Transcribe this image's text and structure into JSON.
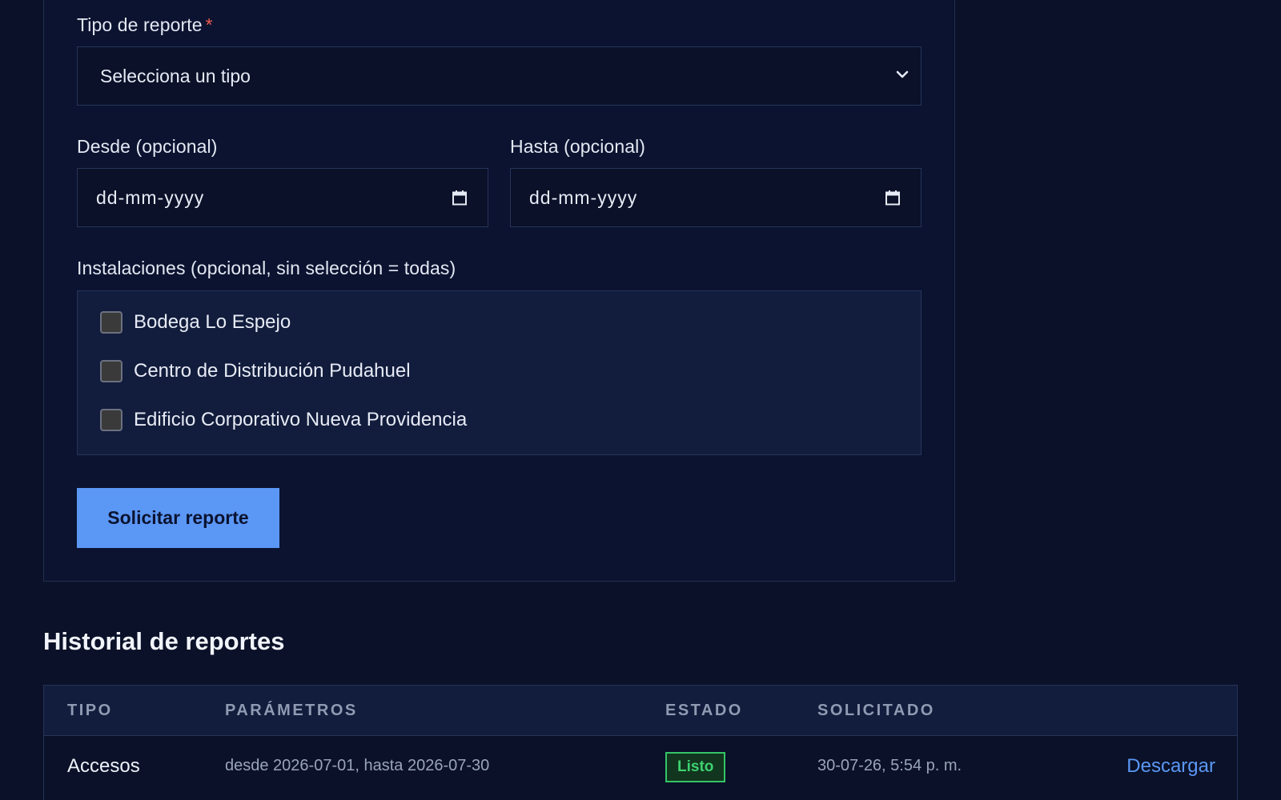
{
  "form": {
    "report_type_label": "Tipo de reporte",
    "required_mark": "*",
    "report_type_value": "Selecciona un tipo",
    "from_label": "Desde (opcional)",
    "from_placeholder": "dd-mm-yyyy",
    "to_label": "Hasta (opcional)",
    "to_placeholder": "dd-mm-yyyy",
    "facilities_label": "Instalaciones (opcional, sin selección = todas)",
    "facilities": [
      {
        "label": "Bodega Lo Espejo",
        "checked": false
      },
      {
        "label": "Centro de Distribución Pudahuel",
        "checked": false
      },
      {
        "label": "Edificio Corporativo Nueva Providencia",
        "checked": false
      }
    ],
    "submit_label": "Solicitar reporte"
  },
  "history": {
    "title": "Historial de reportes",
    "columns": [
      "TIPO",
      "PARÁMETROS",
      "ESTADO",
      "SOLICITADO"
    ],
    "rows": [
      {
        "type": "Accesos",
        "params": "desde 2026-07-01, hasta 2026-07-30",
        "status": "Listo",
        "requested": "30-07-26, 5:54 p. m.",
        "action": "Descargar"
      }
    ]
  },
  "colors": {
    "background": "#0a1128",
    "accent": "#5b97f5",
    "status_ready": "#3ed170",
    "required": "#f05a4f"
  },
  "icons": {
    "select": "chevron-down-icon",
    "date": "calendar-icon"
  }
}
